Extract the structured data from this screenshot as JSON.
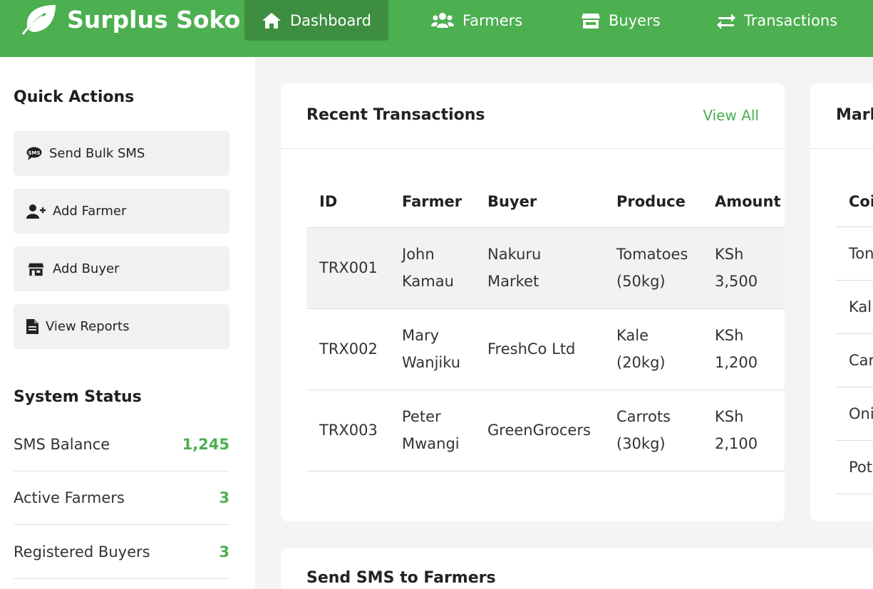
{
  "header": {
    "brand": "Surplus Soko",
    "nav": [
      {
        "label": "Dashboard",
        "icon": "home-icon",
        "active": true
      },
      {
        "label": "Farmers",
        "icon": "users-icon"
      },
      {
        "label": "Buyers",
        "icon": "store-icon"
      },
      {
        "label": "Transactions",
        "icon": "exchange-icon"
      }
    ]
  },
  "sidebar": {
    "quick_actions_title": "Quick Actions",
    "actions": [
      {
        "label": "Send Bulk SMS",
        "icon": "sms-icon"
      },
      {
        "label": "Add Farmer",
        "icon": "user-plus-icon"
      },
      {
        "label": "Add Buyer",
        "icon": "store-icon"
      },
      {
        "label": "View Reports",
        "icon": "document-icon"
      }
    ],
    "status_title": "System Status",
    "status": [
      {
        "label": "SMS Balance",
        "value": "1,245"
      },
      {
        "label": "Active Farmers",
        "value": "3"
      },
      {
        "label": "Registered Buyers",
        "value": "3"
      }
    ]
  },
  "transactions": {
    "title": "Recent Transactions",
    "view_all": "View All",
    "columns": [
      "ID",
      "Farmer",
      "Buyer",
      "Produce",
      "Amount"
    ],
    "rows": [
      {
        "id": "TRX001",
        "farmer": [
          "John",
          "Kamau"
        ],
        "buyer": [
          "Nakuru",
          "Market"
        ],
        "produce": [
          "Tomatoes",
          "(50kg)"
        ],
        "amount": [
          "KSh",
          "3,500"
        ]
      },
      {
        "id": "TRX002",
        "farmer": [
          "Mary",
          "Wanjiku"
        ],
        "buyer": [
          "FreshCo Ltd"
        ],
        "produce": [
          "Kale",
          "(20kg)"
        ],
        "amount": [
          "KSh",
          "1,200"
        ]
      },
      {
        "id": "TRX003",
        "farmer": [
          "Peter",
          "Mwangi"
        ],
        "buyer": [
          "GreenGrocers"
        ],
        "produce": [
          "Carrots",
          "(30kg)"
        ],
        "amount": [
          "KSh",
          "2,100"
        ]
      }
    ]
  },
  "market": {
    "title": "Marl",
    "column": "Coi",
    "rows": [
      "Ton",
      "Kal",
      "Car",
      "Oni",
      "Pot"
    ]
  },
  "sms_card": {
    "title": "Send SMS to Farmers"
  }
}
